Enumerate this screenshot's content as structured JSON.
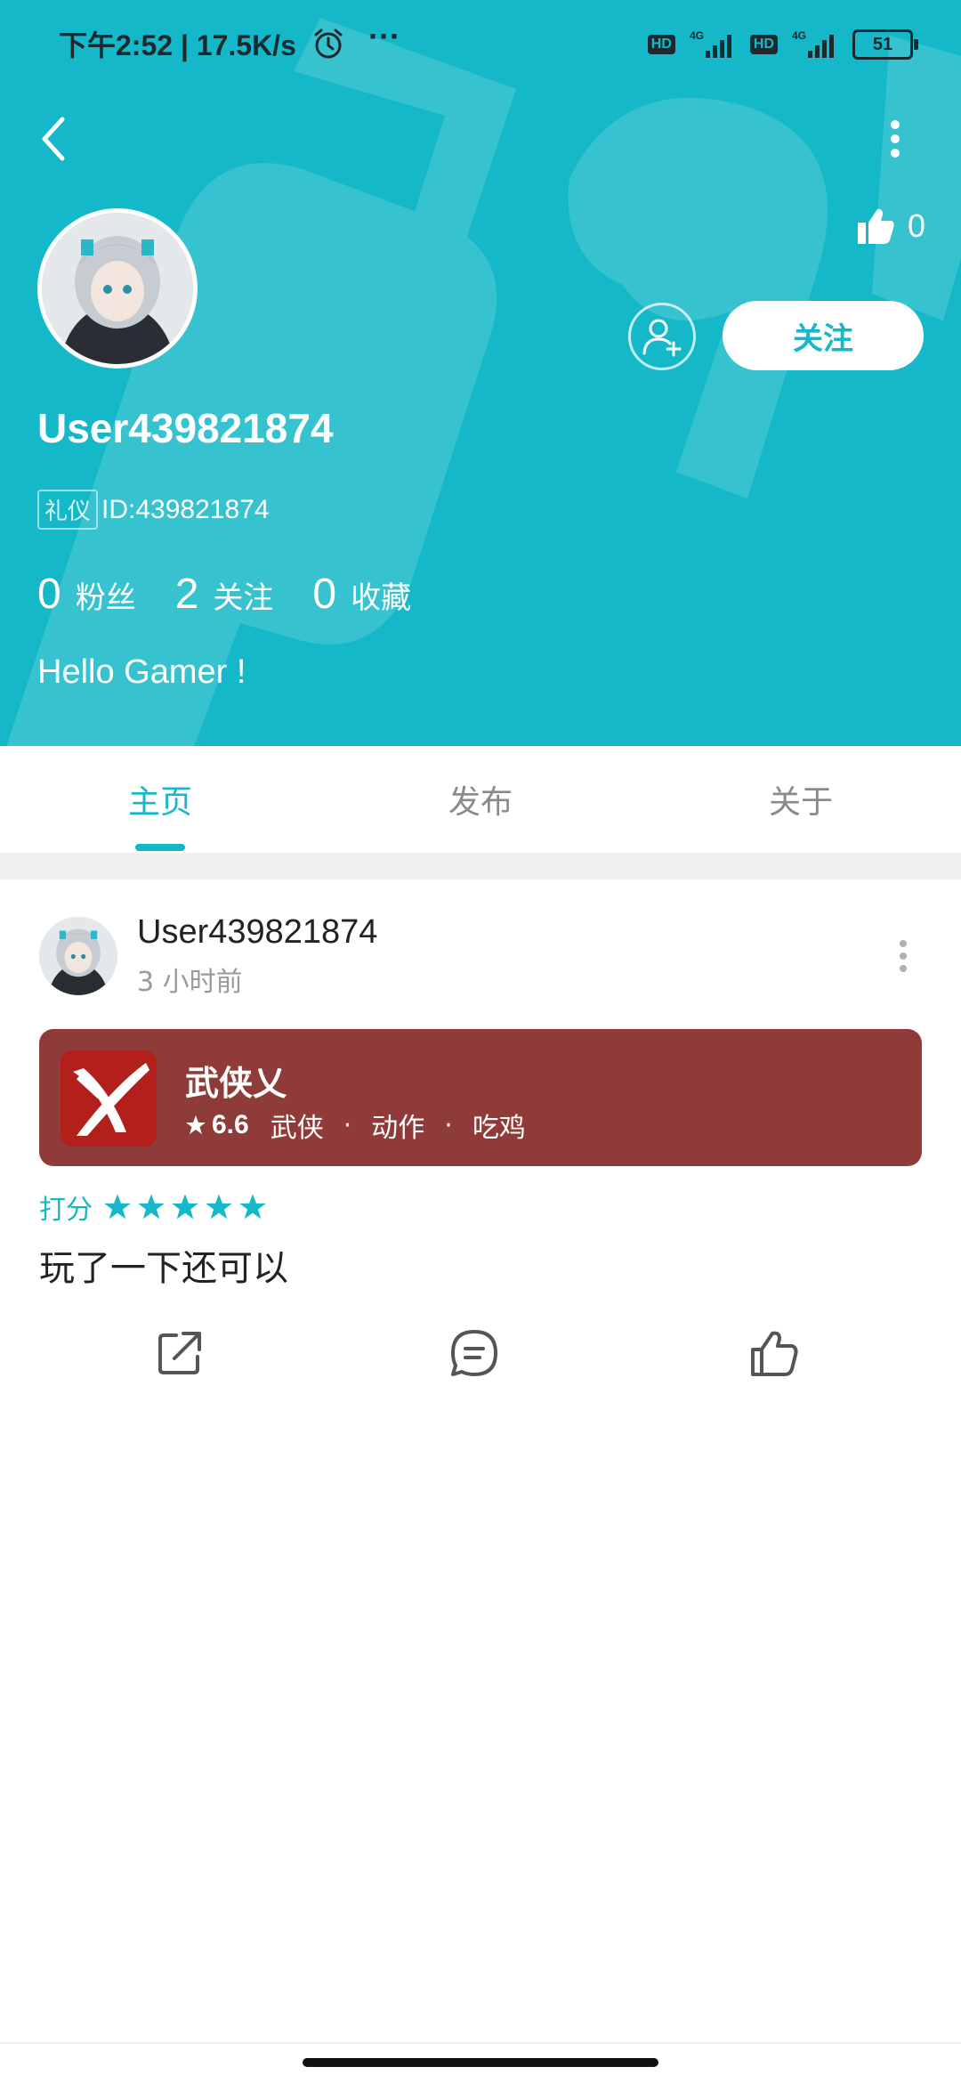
{
  "status_bar": {
    "time": "下午2:52 | 17.5K/s",
    "dots": "···",
    "hd1": "HD",
    "hd2": "HD",
    "net1": "4G",
    "net2": "4G",
    "battery": "51"
  },
  "profile": {
    "like_count": "0",
    "follow_label": "关注",
    "username": "User439821874",
    "title_badge": "礼仪",
    "user_id": "ID:439821874",
    "stats": [
      {
        "value": "0",
        "label": "粉丝"
      },
      {
        "value": "2",
        "label": "关注"
      },
      {
        "value": "0",
        "label": "收藏"
      }
    ],
    "bio": "Hello Gamer !"
  },
  "tabs": [
    {
      "label": "主页",
      "active": true
    },
    {
      "label": "发布",
      "active": false
    },
    {
      "label": "关于",
      "active": false
    }
  ],
  "post": {
    "author": "User439821874",
    "time": "3 小时前",
    "game": {
      "name": "武侠乂",
      "rating": "6.6",
      "tags": [
        "武侠",
        "动作",
        "吃鸡"
      ]
    },
    "rating_label": "打分",
    "stars": 5,
    "text": "玩了一下还可以"
  },
  "colors": {
    "accent": "#15b8c8",
    "game_card_bg": "#8f3b39"
  }
}
